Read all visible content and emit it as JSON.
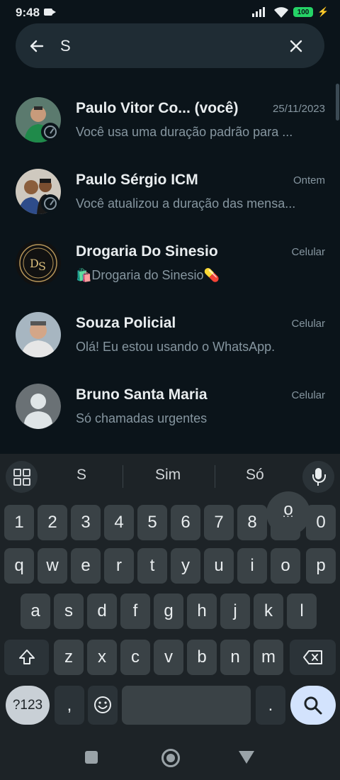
{
  "status": {
    "time": "9:48",
    "battery": "100"
  },
  "search": {
    "query": "S"
  },
  "contacts": [
    {
      "name": "Paulo Vitor Co... (você)",
      "date": "25/11/2023",
      "message": "Você usa uma duração padrão para ..."
    },
    {
      "name": "Paulo Sérgio ICM",
      "date": "Ontem",
      "message": "Você atualizou a duração das mensa..."
    },
    {
      "name": "Drogaria Do Sinesio",
      "date": "Celular",
      "message": "🛍️Drogaria do Sinesio💊"
    },
    {
      "name": "Souza Policial",
      "date": "Celular",
      "message": "Olá! Eu estou usando o WhatsApp."
    },
    {
      "name": "Bruno Santa Maria",
      "date": "Celular",
      "message": "Só chamadas urgentes"
    }
  ],
  "keyboard": {
    "suggestions": [
      "S",
      "Sim",
      "Só"
    ],
    "numbers": [
      "1",
      "2",
      "3",
      "4",
      "5",
      "6",
      "7",
      "8",
      "9",
      "0"
    ],
    "popup_main": "o",
    "popup_sub": "...",
    "row1": [
      "q",
      "w",
      "e",
      "r",
      "t",
      "y",
      "u",
      "i",
      "o",
      "p"
    ],
    "row2": [
      "a",
      "s",
      "d",
      "f",
      "g",
      "h",
      "j",
      "k",
      "l"
    ],
    "row3": [
      "z",
      "x",
      "c",
      "v",
      "b",
      "n",
      "m"
    ],
    "symbols_label": "?123",
    "comma": ",",
    "period": "."
  },
  "icons": {
    "back": "arrow-left-icon",
    "clear": "close-icon",
    "mic": "mic-icon",
    "search": "search-icon",
    "emoji": "emoji-icon",
    "shift": "shift-icon",
    "backspace": "backspace-icon",
    "apps": "grid-icon"
  },
  "colors": {
    "background": "#0b141a",
    "search_bar": "#1f2c34",
    "accent": "#25d366",
    "keyboard": "#1d2327"
  }
}
